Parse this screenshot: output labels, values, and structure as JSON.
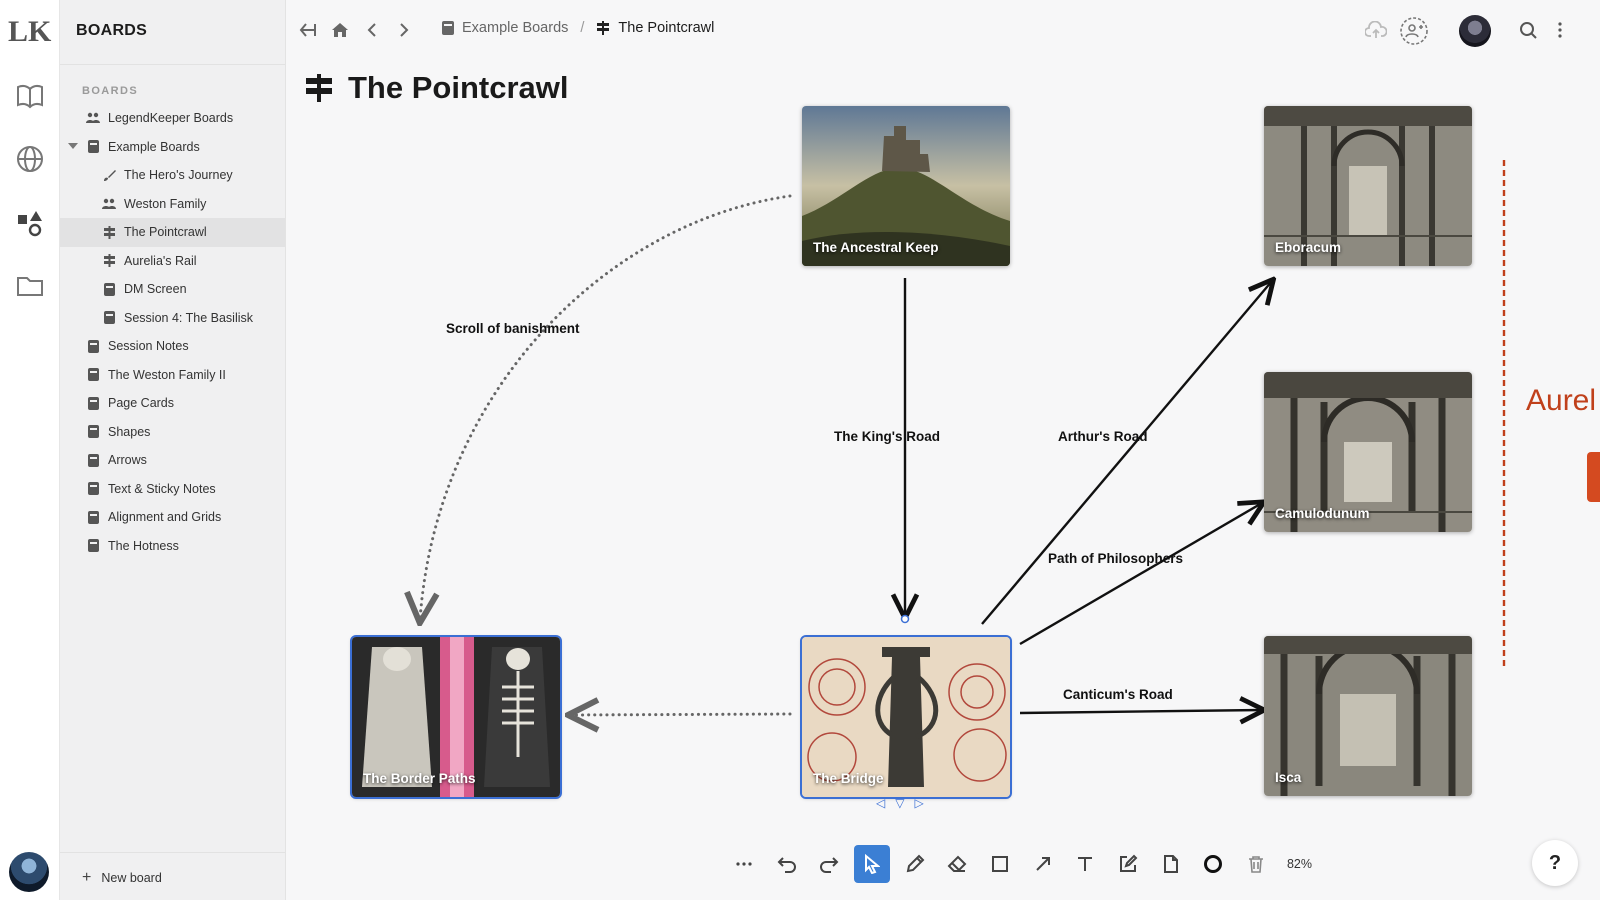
{
  "app": {
    "logo_text": "LK"
  },
  "sidebar": {
    "title": "BOARDS",
    "section_label": "BOARDS",
    "items": [
      {
        "label": "LegendKeeper Boards",
        "icon": "people-icon",
        "level": 0
      },
      {
        "label": "Example Boards",
        "icon": "board-icon",
        "level": 0,
        "expanded": true
      },
      {
        "label": "The Hero's Journey",
        "icon": "brush-icon",
        "level": 1
      },
      {
        "label": "Weston Family",
        "icon": "people-icon",
        "level": 1
      },
      {
        "label": "The Pointcrawl",
        "icon": "signpost-icon",
        "level": 1,
        "active": true
      },
      {
        "label": "Aurelia's Rail",
        "icon": "signpost-icon",
        "level": 1
      },
      {
        "label": "DM Screen",
        "icon": "board-icon",
        "level": 1
      },
      {
        "label": "Session 4: The Basilisk",
        "icon": "board-icon",
        "level": 1
      },
      {
        "label": "Session Notes",
        "icon": "board-icon",
        "level": 0
      },
      {
        "label": "The Weston Family II",
        "icon": "board-icon",
        "level": 0
      },
      {
        "label": "Page Cards",
        "icon": "board-icon",
        "level": 0
      },
      {
        "label": "Shapes",
        "icon": "board-icon",
        "level": 0
      },
      {
        "label": "Arrows",
        "icon": "board-icon",
        "level": 0
      },
      {
        "label": "Text & Sticky Notes",
        "icon": "board-icon",
        "level": 0
      },
      {
        "label": "Alignment and Grids",
        "icon": "board-icon",
        "level": 0
      },
      {
        "label": "The Hotness",
        "icon": "board-icon",
        "level": 0
      }
    ],
    "new_board_label": "New board"
  },
  "header": {
    "breadcrumb_parent": "Example Boards",
    "breadcrumb_separator": "/",
    "breadcrumb_current": "The Pointcrawl"
  },
  "board": {
    "title": "The Pointcrawl",
    "cards": {
      "keep": "The Ancestral Keep",
      "eboracum": "Eboracum",
      "camulodunum": "Camulodunum",
      "isca": "Isca",
      "border": "The Border Paths",
      "bridge": "The Bridge"
    },
    "edge_labels": {
      "scroll": "Scroll of banishment",
      "kings_road": "The King's Road",
      "arthurs_road": "Arthur's Road",
      "philosophers": "Path of Philosophers",
      "canticums": "Canticum's Road"
    },
    "offscreen_text": "Aurel"
  },
  "toolbar": {
    "tools": [
      "more-icon",
      "undo-icon",
      "redo-icon",
      "select-icon",
      "pencil-icon",
      "eraser-icon",
      "rectangle-icon",
      "arrow-icon",
      "text-icon",
      "note-icon",
      "page-icon",
      "circle-icon",
      "trash-icon"
    ],
    "active_tool": "select-icon",
    "zoom": "82%"
  },
  "help_label": "?",
  "colors": {
    "accent": "#3b7fd4",
    "rail_red": "#c0401b"
  }
}
